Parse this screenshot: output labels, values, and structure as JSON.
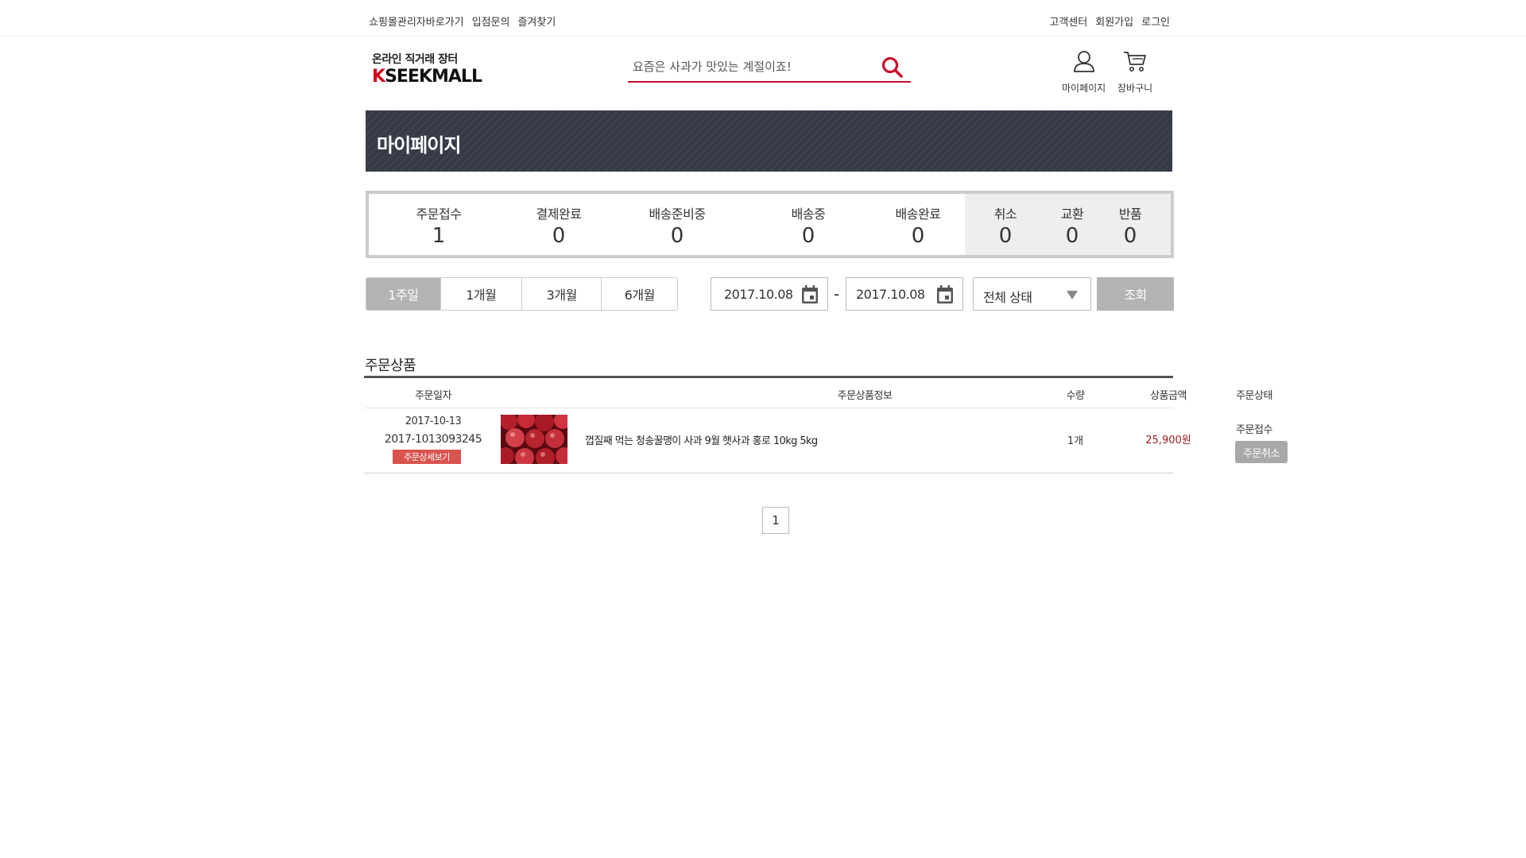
{
  "topbar": {
    "left_links": [
      "쇼핑몰관리자바로가기",
      "입점문의",
      "즐겨찾기"
    ],
    "right_links": [
      "고객센터",
      "회원가입",
      "로그인"
    ]
  },
  "header": {
    "logo_sub": "온라인 직거래 장터",
    "logo_k": "K",
    "logo_rest": "SEEKMALL",
    "search_placeholder": "요즘은 사과가 맛있는 계절이죠!",
    "mypage_label": "마이페이지",
    "cart_label": "장바구니"
  },
  "banner": {
    "title": "마이페이지"
  },
  "order_status": {
    "items": [
      {
        "label": "주문접수",
        "value": "1"
      },
      {
        "label": "결제완료",
        "value": "0"
      },
      {
        "label": "배송준비중",
        "value": "0"
      },
      {
        "label": "배송중",
        "value": "0"
      },
      {
        "label": "배송완료",
        "value": "0"
      }
    ],
    "side_items": [
      {
        "label": "취소",
        "value": "0"
      },
      {
        "label": "교환",
        "value": "0"
      },
      {
        "label": "반품",
        "value": "0"
      }
    ]
  },
  "filter": {
    "periods": [
      "1주일",
      "1개월",
      "3개월",
      "6개월"
    ],
    "active_period": "1주일",
    "start_date": "2017.10.08",
    "end_date": "2017.10.08",
    "date_separator": "-",
    "status_select": "전체 상태",
    "search_button": "조회"
  },
  "orders": {
    "section_title": "주문상품",
    "columns": [
      "주문일자",
      "주문상품정보",
      "수량",
      "상품금액",
      "주문상태"
    ],
    "rows": [
      {
        "date": "2017-10-13",
        "order_number": "2017-1013093245",
        "detail_button": "주문상세보기",
        "product_name": "껍질째 먹는 청송꿀맹이 사과 9월 햇사과 홍로 10kg 5kg",
        "quantity": "1개",
        "price": "25,900원",
        "status": "주문접수",
        "cancel_button": "주문취소"
      }
    ]
  },
  "pagination": {
    "current": "1"
  },
  "colors": {
    "accent": "#c8102e",
    "banner": "#353a46",
    "price": "#9b1c1c",
    "detail_button": "#d9534f",
    "muted_button": "#b3b3b3"
  }
}
